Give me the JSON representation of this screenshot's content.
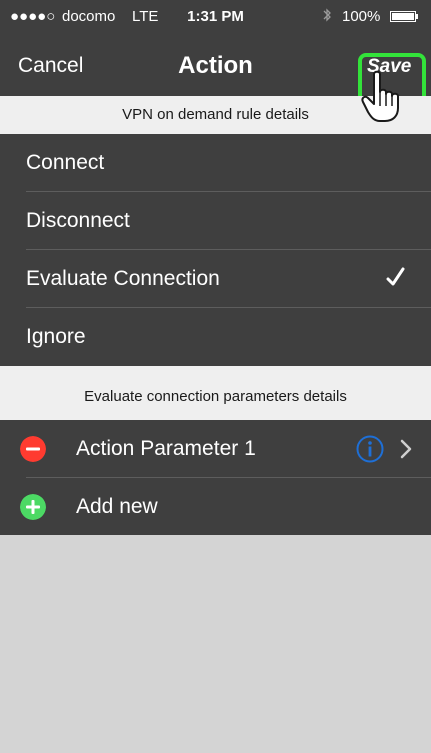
{
  "status_bar": {
    "signal": "●●●●○",
    "carrier": "docomo",
    "network": "LTE",
    "time": "1:31 PM",
    "battery": "100%"
  },
  "nav": {
    "cancel_label": "Cancel",
    "title": "Action",
    "save_label": "Save"
  },
  "vpn_section": {
    "header": "VPN on demand rule details",
    "options": [
      {
        "label": "Connect",
        "selected": false
      },
      {
        "label": "Disconnect",
        "selected": false
      },
      {
        "label": "Evaluate Connection",
        "selected": true
      },
      {
        "label": "Ignore",
        "selected": false
      }
    ]
  },
  "params_section": {
    "header": "Evaluate connection parameters details",
    "items": [
      {
        "label": "Action Parameter 1"
      }
    ],
    "add_label": "Add new"
  },
  "colors": {
    "bar": "#3f3f3f",
    "header_bg": "#efefef",
    "highlight": "#33e33a",
    "remove": "#ff3b30",
    "add": "#4cd964",
    "info": "#1e6fd6"
  }
}
